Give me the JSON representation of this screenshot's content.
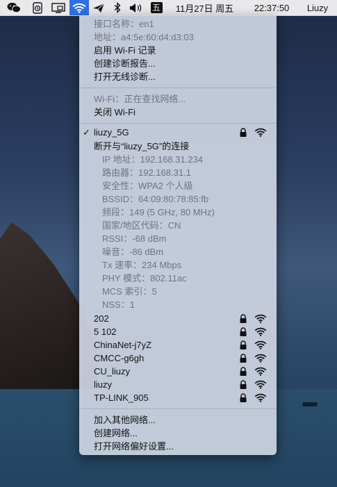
{
  "menubar": {
    "date": "11月27日 周五",
    "time": "22:37:50",
    "user": "Liuzy",
    "input_method": "五"
  },
  "menu": {
    "interface_name": "接口名称：en1",
    "address": "地址：a4:5e:60:d4:d3:03",
    "enable_logging": "启用 Wi-Fi 记录",
    "create_report": "创建诊断报告...",
    "open_diagnostics": "打开无线诊断...",
    "wifi_status": "Wi-Fi：正在查找网络...",
    "turn_off": "关闭 Wi-Fi",
    "connected_network": "liuzy_5G",
    "disconnect": "断开与“liuzy_5G”的连接",
    "details": [
      "IP 地址：192.168.31.234",
      "路由器：192.168.31.1",
      "安全性：WPA2 个人级",
      "BSSID：64:09:80:78:85:fb",
      "频段：149 (5 GHz, 80 MHz)",
      "国家/地区代码：CN",
      "RSSI：-68 dBm",
      "噪音：-86 dBm",
      "Tx 速率：234 Mbps",
      "PHY 模式：802.11ac",
      "MCS 索引：5",
      "NSS：1"
    ],
    "networks": [
      "202",
      "5 102",
      "ChinaNet-j7yZ",
      "CMCC-g6gh",
      "CU_liuzy",
      "liuzy",
      "TP-LINK_905"
    ],
    "join_other": "加入其他网络...",
    "create_network": "创建网络...",
    "open_prefs": "打开网络偏好设置..."
  },
  "colors": {
    "accent": "#2f6fe3",
    "menu_bg": "#cdd4e2",
    "disabled_text": "#6d7380"
  }
}
